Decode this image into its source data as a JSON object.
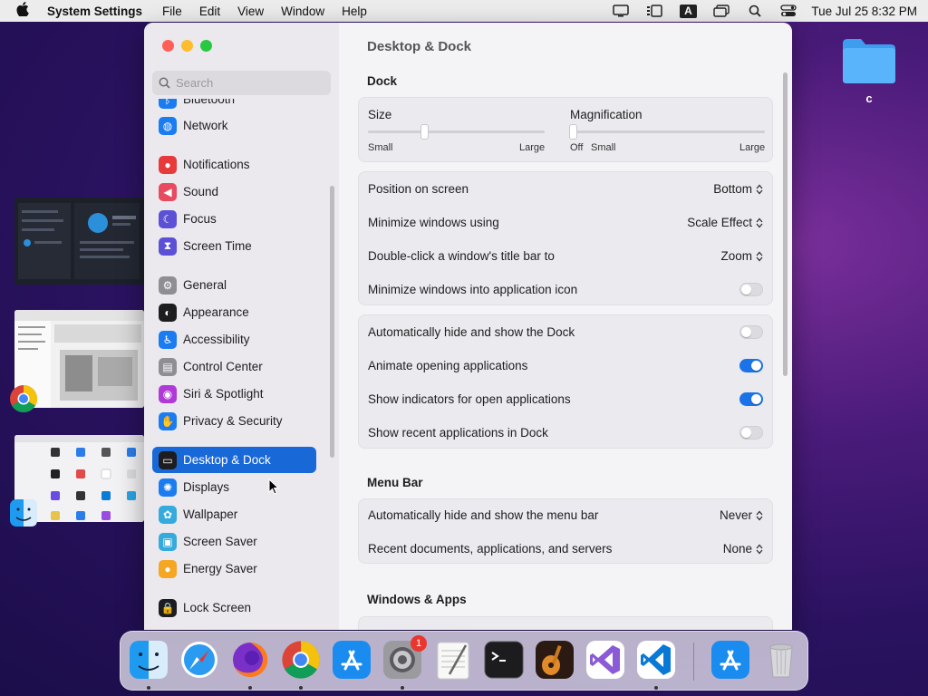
{
  "menubar": {
    "app_name": "System Settings",
    "menus": [
      "File",
      "Edit",
      "View",
      "Window",
      "Help"
    ],
    "clock": "Tue Jul 25  8:32 PM",
    "input_indicator": "A"
  },
  "desktop": {
    "folder_label": "c"
  },
  "window": {
    "search_placeholder": "Search",
    "sidebar": {
      "partial_item": "Bluetooth",
      "items": [
        {
          "label": "Network",
          "icon": "globe-icon",
          "color": "#1a7cf0"
        },
        {
          "label": "Notifications",
          "icon": "bell-icon",
          "color": "#e83a3a"
        },
        {
          "label": "Sound",
          "icon": "speaker-icon",
          "color": "#e84a5f"
        },
        {
          "label": "Focus",
          "icon": "moon-icon",
          "color": "#5b50d6"
        },
        {
          "label": "Screen Time",
          "icon": "hourglass-icon",
          "color": "#5b50d6"
        },
        {
          "label": "General",
          "icon": "gear-icon",
          "color": "#8e8e93"
        },
        {
          "label": "Appearance",
          "icon": "appearance-icon",
          "color": "#1d1d1f"
        },
        {
          "label": "Accessibility",
          "icon": "accessibility-icon",
          "color": "#1a7cf0"
        },
        {
          "label": "Control Center",
          "icon": "control-center-icon",
          "color": "#8e8e93"
        },
        {
          "label": "Siri & Spotlight",
          "icon": "siri-icon",
          "color": "#b03ad8"
        },
        {
          "label": "Privacy & Security",
          "icon": "hand-icon",
          "color": "#1a7cf0"
        },
        {
          "label": "Desktop & Dock",
          "icon": "dock-icon",
          "color": "#1d1d1f"
        },
        {
          "label": "Displays",
          "icon": "sun-icon",
          "color": "#1a7cf0"
        },
        {
          "label": "Wallpaper",
          "icon": "flower-icon",
          "color": "#35aadc"
        },
        {
          "label": "Screen Saver",
          "icon": "screensaver-icon",
          "color": "#35aadc"
        },
        {
          "label": "Energy Saver",
          "icon": "bulb-icon",
          "color": "#f5a623"
        },
        {
          "label": "Lock Screen",
          "icon": "lock-icon",
          "color": "#1d1d1f"
        }
      ],
      "selected": "Desktop & Dock"
    },
    "content": {
      "title": "Desktop & Dock",
      "dock_section": "Dock",
      "size_label": "Size",
      "size_min": "Small",
      "size_max": "Large",
      "size_value": 0.32,
      "magnification_label": "Magnification",
      "mag_off": "Off",
      "mag_min": "Small",
      "mag_max": "Large",
      "mag_value": 0.0,
      "dock_rows": [
        {
          "label": "Position on screen",
          "value": "Bottom"
        },
        {
          "label": "Minimize windows using",
          "value": "Scale Effect"
        },
        {
          "label": "Double-click a window's title bar to",
          "value": "Zoom"
        },
        {
          "label": "Minimize windows into application icon",
          "toggle": false
        }
      ],
      "dock_toggles": [
        {
          "label": "Automatically hide and show the Dock",
          "toggle": false
        },
        {
          "label": "Animate opening applications",
          "toggle": true
        },
        {
          "label": "Show indicators for open applications",
          "toggle": true
        },
        {
          "label": "Show recent applications in Dock",
          "toggle": false
        }
      ],
      "menubar_section": "Menu Bar",
      "menubar_rows": [
        {
          "label": "Automatically hide and show the menu bar",
          "value": "Never"
        },
        {
          "label": "Recent documents, applications, and servers",
          "value": "None"
        }
      ],
      "windows_section": "Windows & Apps"
    }
  },
  "dock": {
    "apps": [
      {
        "name": "Finder",
        "icon": "finder-icon",
        "running": true
      },
      {
        "name": "Safari",
        "icon": "safari-icon",
        "running": false
      },
      {
        "name": "Firefox",
        "icon": "firefox-icon",
        "running": true
      },
      {
        "name": "Chrome",
        "icon": "chrome-icon",
        "running": true
      },
      {
        "name": "App Store",
        "icon": "app-store-icon",
        "running": false
      },
      {
        "name": "System Settings",
        "icon": "system-settings-icon",
        "running": true,
        "badge": "1"
      },
      {
        "name": "TextEdit",
        "icon": "textedit-icon",
        "running": false
      },
      {
        "name": "Terminal",
        "icon": "terminal-icon",
        "running": false
      },
      {
        "name": "GarageBand",
        "icon": "guitar-icon",
        "running": false
      },
      {
        "name": "Visual Studio",
        "icon": "visual-studio-icon",
        "running": false
      },
      {
        "name": "VS Code",
        "icon": "vscode-icon",
        "running": true
      },
      {
        "name": "App Store",
        "icon": "app-store-icon",
        "running": false
      },
      {
        "name": "Trash",
        "icon": "trash-icon",
        "running": false
      }
    ]
  }
}
